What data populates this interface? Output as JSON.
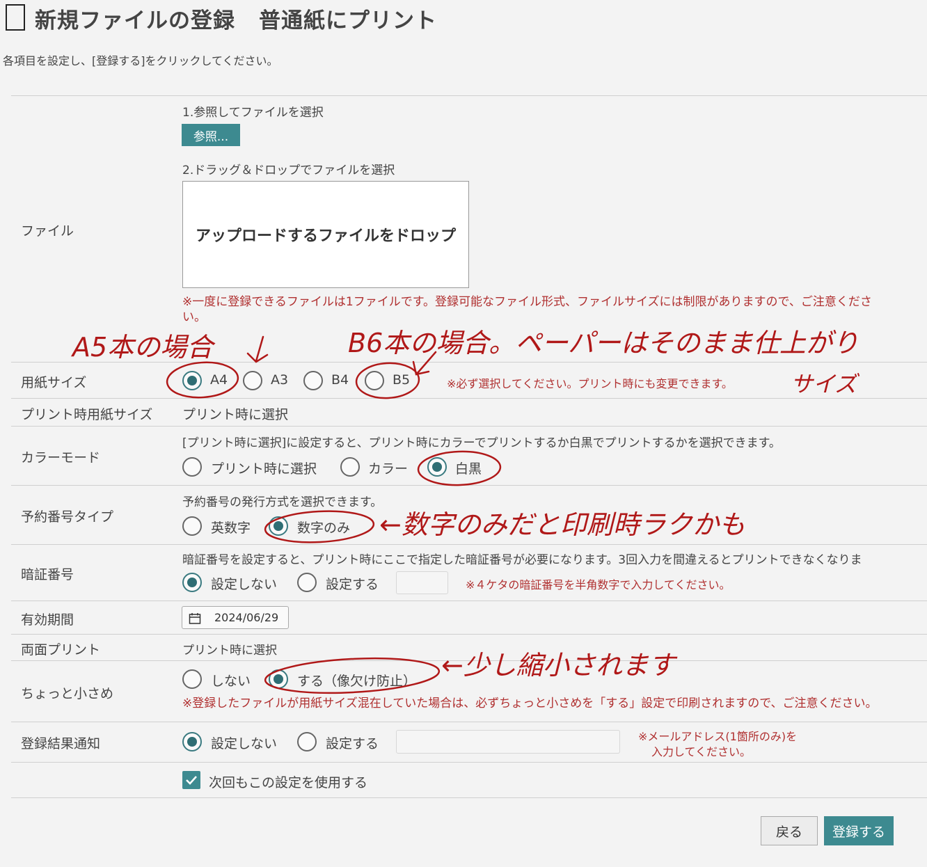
{
  "header": {
    "title": "新規ファイルの登録",
    "subtitle": "普通紙にプリント",
    "instruction": "各項目を設定し、[登録する]をクリックしてください。"
  },
  "file": {
    "label": "ファイル",
    "step1": "1.参照してファイルを選択",
    "browse_button": "参照...",
    "step2": "2.ドラッグ＆ドロップでファイルを選択",
    "dropzone_text": "アップロードするファイルをドロップ",
    "notice_line1": "※一度に登録できるファイルは1ファイルです。登録可能なファイル形式、ファイルサイズには制限がありますので、ご注意くださ",
    "notice_line2": "い。"
  },
  "paper_size": {
    "label": "用紙サイズ",
    "options": [
      "A4",
      "A3",
      "B4",
      "B5"
    ],
    "selected": "A4",
    "notice": "※必ず選択してください。プリント時にも変更できます。"
  },
  "print_paper_size": {
    "label": "プリント時用紙サイズ",
    "value": "プリント時に選択"
  },
  "color_mode": {
    "label": "カラーモード",
    "description": "[プリント時に選択]に設定すると、プリント時にカラーでプリントするか白黒でプリントするかを選択できます。",
    "options": [
      "プリント時に選択",
      "カラー",
      "白黒"
    ],
    "selected": "白黒"
  },
  "reservation_type": {
    "label": "予約番号タイプ",
    "description": "予約番号の発行方式を選択できます。",
    "options": [
      "英数字",
      "数字のみ"
    ],
    "selected": "数字のみ"
  },
  "pin": {
    "label": "暗証番号",
    "description": "暗証番号を設定すると、プリント時にここで指定した暗証番号が必要になります。3回入力を間違えるとプリントできなくなりま",
    "options": [
      "設定しない",
      "設定する"
    ],
    "selected": "設定しない",
    "input_value": "",
    "notice": "※４ケタの暗証番号を半角数字で入力してください。"
  },
  "expiry": {
    "label": "有効期間",
    "value": "2024/06/29",
    "icon": "calendar-icon"
  },
  "duplex": {
    "label": "両面プリント",
    "value": "プリント時に選択"
  },
  "slightly_smaller": {
    "label": "ちょっと小さめ",
    "options": [
      "しない",
      "する（像欠け防止）"
    ],
    "selected": "する（像欠け防止）",
    "notice": "※登録したファイルが用紙サイズ混在していた場合は、必ずちょっと小さめを「する」設定で印刷されますので、ご注意ください。"
  },
  "notification": {
    "label": "登録結果通知",
    "options": [
      "設定しない",
      "設定する"
    ],
    "selected": "設定しない",
    "input_value": "",
    "notice_line1": "※メールアドレス(1箇所のみ)を",
    "notice_line2": "入力してください。"
  },
  "remember": {
    "label": "次回もこの設定を使用する",
    "checked": true
  },
  "footer": {
    "back_button": "戻る",
    "submit_button": "登録する"
  },
  "annotations": {
    "a5": "A5本の場合",
    "b6": "B6本の場合。ペーパーはそのまま仕上がり",
    "b6_cont": "サイズ",
    "digits": "←数字のみだと印刷時ラクかも",
    "shrink": "←少し縮小されます",
    "ink_color": "#b01818"
  },
  "colors": {
    "accent": "#3d8a90",
    "notice_red": "#b03030",
    "background": "#f3f3f3"
  }
}
